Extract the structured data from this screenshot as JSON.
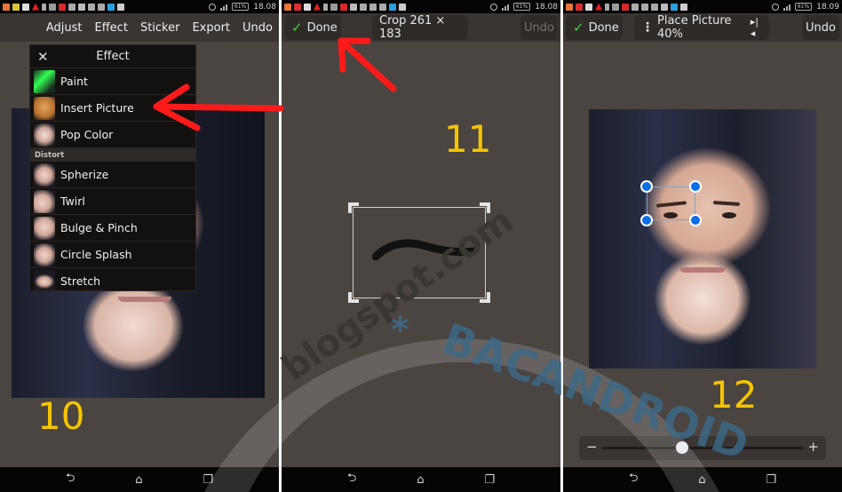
{
  "status_bar": {
    "panel10_time": "18.08",
    "panel11_time": "18.08",
    "panel12_time": "18.09",
    "battery": "61%"
  },
  "panel10": {
    "toolbar": [
      "Adjust",
      "Effect",
      "Sticker",
      "Export",
      "Undo"
    ],
    "menu": {
      "title": "Effect",
      "close_icon": "close-icon",
      "items_top": [
        {
          "label": "Paint",
          "thumb": "paint-thumbnail"
        },
        {
          "label": "Insert Picture",
          "thumb": "dog-face-thumbnail"
        },
        {
          "label": "Pop Color",
          "thumb": "face-thumbnail"
        }
      ],
      "section": "Distort",
      "items_distort": [
        {
          "label": "Spherize"
        },
        {
          "label": "Twirl"
        },
        {
          "label": "Bulge & Pinch"
        },
        {
          "label": "Circle Splash"
        },
        {
          "label": "Stretch"
        }
      ]
    },
    "step_number": "10"
  },
  "panel11": {
    "done_label": "Done",
    "crop_label": "Crop 261 × 183",
    "undo_label": "Undo",
    "step_number": "11"
  },
  "panel12": {
    "done_label": "Done",
    "place_label": "Place Picture 40%",
    "undo_label": "Undo",
    "step_number": "12",
    "slider": {
      "minus": "−",
      "plus": "+",
      "value_fraction": 0.4
    }
  },
  "nav": {
    "back": "back-icon",
    "home": "home-icon",
    "recents": "recents-icon"
  },
  "watermark": {
    "text_left": "blogspot.com",
    "separator": "*",
    "text_right": "BACANDROID"
  },
  "colors": {
    "accent_yellow": "#f5c400",
    "handle_blue": "#0b6fe8",
    "check_green": "#4ccf3e",
    "arrow_red": "#ff1a1a",
    "bg": "#4a4541"
  }
}
